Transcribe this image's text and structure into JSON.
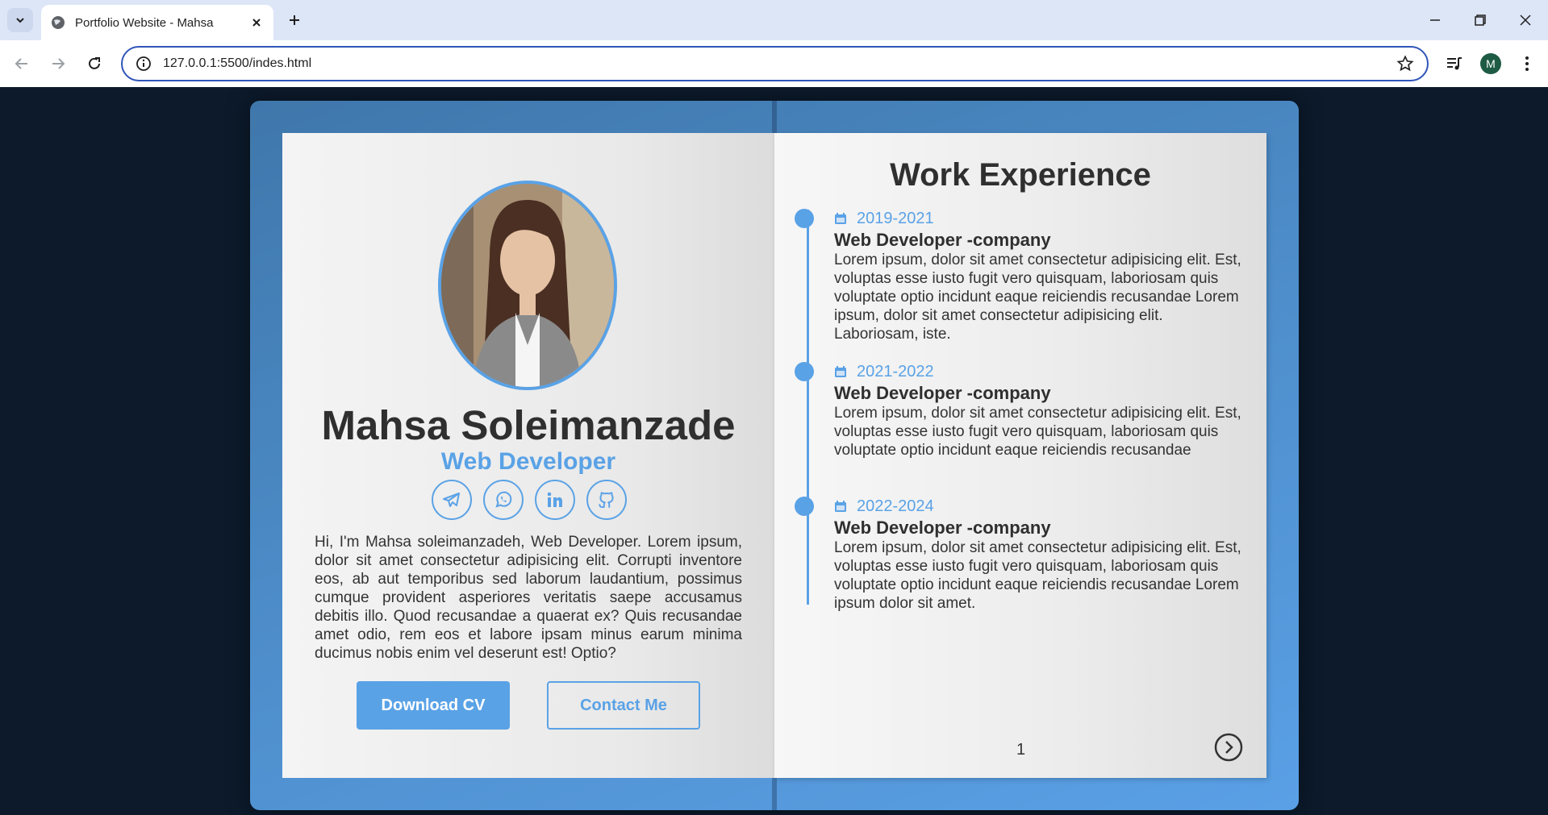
{
  "browser": {
    "tab_title": "Portfolio Website - Mahsa",
    "url": "127.0.0.1:5500/indes.html",
    "profile_initial": "M"
  },
  "profile": {
    "name": "Mahsa Soleimanzade",
    "role": "Web Developer",
    "bio": "Hi, I'm Mahsa soleimanzadeh, Web Developer. Lorem ipsum, dolor sit amet consectetur adipisicing elit. Corrupti inventore eos, ab aut temporibus sed laborum laudantium, possimus cumque provident asperiores veritatis saepe accusamus debitis illo. Quod recusandae a quaerat ex? Quis recusandae amet odio, rem eos et labore ipsam minus earum minima ducimus nobis enim vel deserunt est! Optio?",
    "socials": [
      "telegram-icon",
      "whatsapp-icon",
      "linkedin-icon",
      "github-icon"
    ],
    "download_label": "Download CV",
    "contact_label": "Contact Me"
  },
  "experience": {
    "title": "Work Experience",
    "entries": [
      {
        "date": "2019-2021",
        "job": "Web Developer -company",
        "desc": "Lorem ipsum, dolor sit amet consectetur adipisicing elit. Est, voluptas esse iusto fugit vero quisquam, laboriosam quis voluptate optio incidunt eaque reiciendis recusandae Lorem ipsum, dolor sit amet consectetur adipisicing elit. Laboriosam, iste."
      },
      {
        "date": "2021-2022",
        "job": "Web Developer -company",
        "desc": "Lorem ipsum, dolor sit amet consectetur adipisicing elit. Est, voluptas esse iusto fugit vero quisquam, laboriosam quis voluptate optio incidunt eaque reiciendis recusandae"
      },
      {
        "date": "2022-2024",
        "job": "Web Developer -company",
        "desc": "Lorem ipsum, dolor sit amet consectetur adipisicing elit. Est, voluptas esse iusto fugit vero quisquam, laboriosam quis voluptate optio incidunt eaque reiciendis recusandae Lorem ipsum dolor sit amet."
      }
    ],
    "page_number": "1"
  },
  "colors": {
    "accent": "#5aa2e6",
    "page_background": "#0c1a2b",
    "text": "#2f2f2f"
  }
}
